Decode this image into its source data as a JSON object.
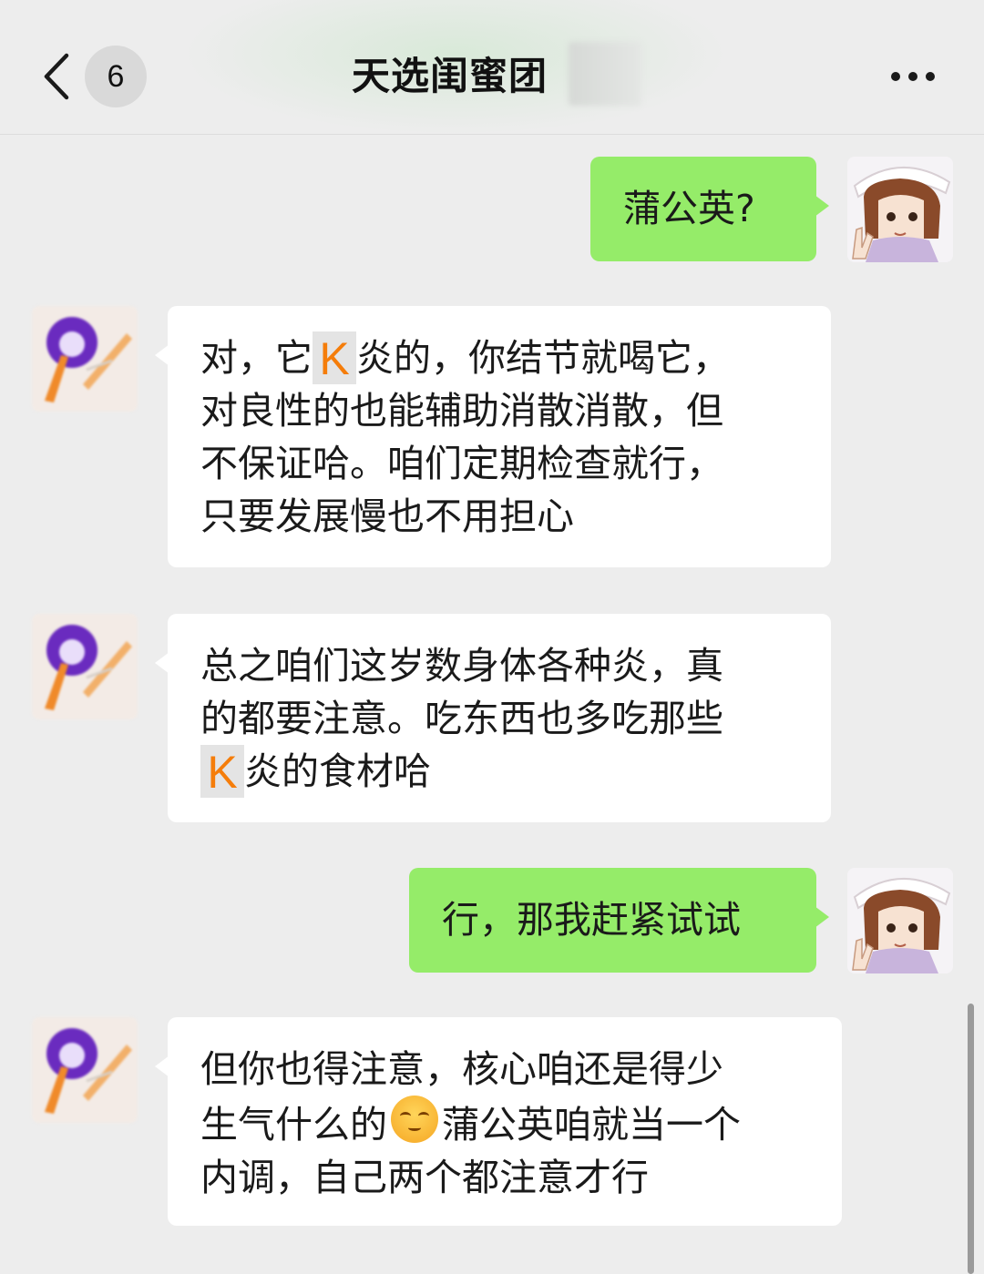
{
  "header": {
    "unread_count": "6",
    "title": "天选闺蜜团",
    "back_icon": "chevron-left-icon",
    "more_icon": "more-dots-icon"
  },
  "messages": [
    {
      "side": "me",
      "lines": [
        "蒲公英?"
      ]
    },
    {
      "side": "them",
      "lines": [
        "对，它",
        "炎的，你结节就喝它，",
        "对良性的也能辅助消散消散，但",
        "不保证哈。咱们定期检查就行，",
        "只要发展慢也不用担心"
      ]
    },
    {
      "side": "them",
      "lines": [
        "总之咱们这岁数身体各种炎，真",
        "的都要注意。吃东西也多吃那些",
        "炎的食材哈"
      ]
    },
    {
      "side": "me",
      "lines": [
        "行，那我赶紧试试"
      ]
    },
    {
      "side": "them",
      "lines": [
        "但你也得注意，核心咱还是得少",
        "生气什么的",
        "蒲公英咱就当一个",
        "内调，自己两个都注意才行"
      ]
    }
  ],
  "censor_mark": "K",
  "emoji_name": "smiling-face-emoji",
  "colors": {
    "background": "#ededed",
    "my_bubble": "#95ec69",
    "their_bubble": "#ffffff",
    "censor_mark": "#f57d0a"
  }
}
